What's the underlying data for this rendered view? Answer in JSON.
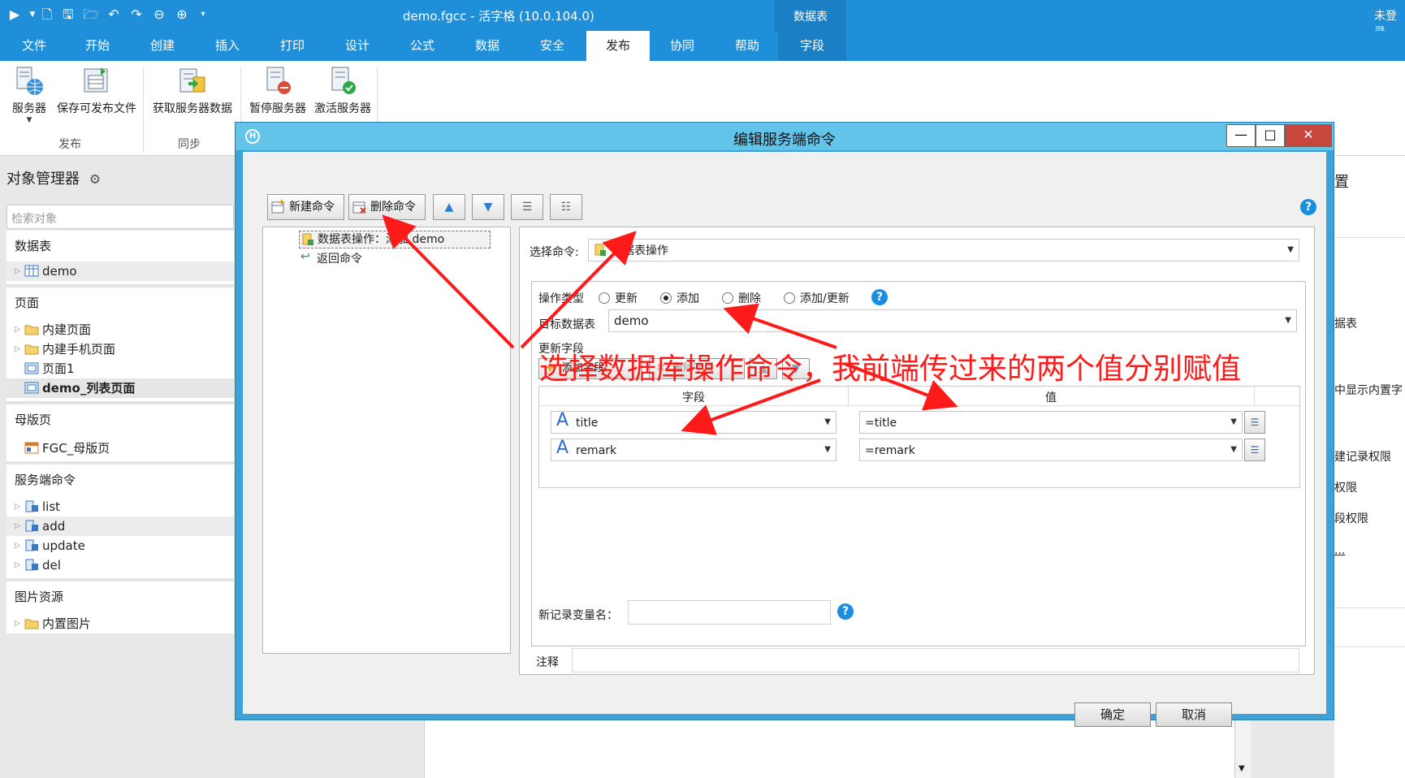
{
  "app": {
    "title": "demo.fgcc - 活字格 (10.0.104.0)",
    "login": "未登录",
    "context_tab": "数据表"
  },
  "tabs": [
    "文件",
    "开始",
    "创建",
    "插入",
    "打印",
    "设计",
    "公式",
    "数据",
    "安全",
    "发布",
    "协同",
    "帮助",
    "字段"
  ],
  "ribbon": {
    "publish": {
      "server": "服务器",
      "save": "保存可发布文件",
      "group": "发布"
    },
    "sync": {
      "fetch": "获取服务器数据",
      "group": "同步"
    },
    "pause": "暂停服务器",
    "activate": "激活服务器"
  },
  "left": {
    "title": "对象管理器",
    "search_placeholder": "检索对象",
    "tables_label": "数据表",
    "table_demo": "demo",
    "pages_label": "页面",
    "page_builtin": "内建页面",
    "page_mobile": "内建手机页面",
    "page1": "页面1",
    "page_list": "demo_列表页面",
    "master_label": "母版页",
    "master": "FGC_母版页",
    "server_cmd_label": "服务端命令",
    "cmd_list": "list",
    "cmd_add": "add",
    "cmd_update": "update",
    "cmd_del": "del",
    "images_label": "图片资源",
    "images_builtin": "内置图片"
  },
  "dialog": {
    "title": "编辑服务端命令",
    "new_cmd": "新建命令",
    "del_cmd": "删除命令",
    "tree_item1": "数据表操作：添加 demo",
    "tree_item2": "返回命令",
    "select_cmd_label": "选择命令:",
    "select_cmd_value": "数据表操作",
    "op_type_label": "操作类型",
    "op_update": "更新",
    "op_add": "添加",
    "op_delete": "删除",
    "op_upsert": "添加/更新",
    "op_selected": "添加",
    "target_label": "目标数据表",
    "target_value": "demo",
    "update_fields_label": "更新字段",
    "add_field_btn": "添加字段",
    "del_field_btn": "删除字段",
    "col_field": "字段",
    "col_value": "值",
    "rows": [
      {
        "field": "title",
        "value": "=title"
      },
      {
        "field": "remark",
        "value": "=remark"
      }
    ],
    "newvar_label": "新记录变量名：",
    "note_label": "注释",
    "ok": "确定",
    "cancel": "取消"
  },
  "right_fragments": [
    "置",
    "据表",
    "中显示内置字",
    "建记录权限",
    "权限",
    "段权限",
    "..."
  ],
  "annotation": "选择数据库操作命令，我前端传过来的两个值分别赋值",
  "colors": {
    "accent": "#1e8fd8",
    "dialog_title": "#63c4ea",
    "annotation": "#ff1a1a"
  }
}
